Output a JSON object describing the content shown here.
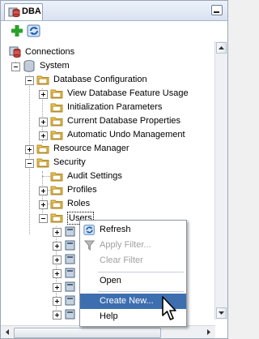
{
  "panel": {
    "tab_title": "DBA"
  },
  "tree": [
    {
      "label": "Connections"
    },
    {
      "label": "System"
    },
    {
      "label": "Database Configuration"
    },
    {
      "label": "View Database Feature Usage"
    },
    {
      "label": "Initialization Parameters"
    },
    {
      "label": "Current Database Properties"
    },
    {
      "label": "Automatic Undo Management"
    },
    {
      "label": "Resource Manager"
    },
    {
      "label": "Security"
    },
    {
      "label": "Audit Settings"
    },
    {
      "label": "Profiles"
    },
    {
      "label": "Roles"
    },
    {
      "label": "Users"
    }
  ],
  "context_menu": {
    "refresh": "Refresh",
    "apply_filter": "Apply Filter...",
    "clear_filter": "Clear Filter",
    "open": "Open",
    "create_new": "Create New...",
    "help": "Help"
  },
  "colors": {
    "highlight": "#3d6fb0",
    "folder": "#f3c64f",
    "add_icon": "#2aa12a"
  },
  "icons": [
    "dba-database-icon",
    "add-icon",
    "refresh-icon",
    "connections-icon",
    "database-icon",
    "folder-icon",
    "object-icon",
    "filter-icon",
    "minimize-icon",
    "mouse-pointer-icon"
  ]
}
